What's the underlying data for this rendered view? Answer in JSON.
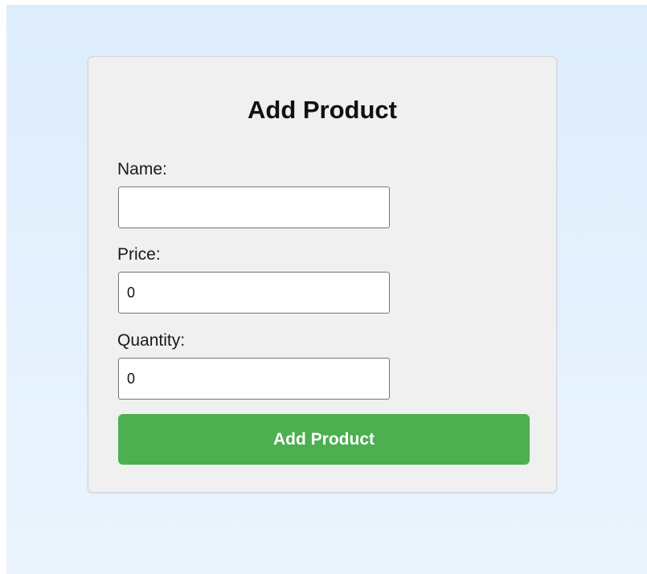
{
  "form": {
    "title": "Add Product",
    "fields": [
      {
        "label": "Name:",
        "value": ""
      },
      {
        "label": "Price:",
        "value": "0"
      },
      {
        "label": "Quantity:",
        "value": "0"
      }
    ],
    "submit_label": "Add Product"
  },
  "colors": {
    "background": "#e3effc",
    "card": "#f0f0f0",
    "button": "#4caf50",
    "button_text": "#ffffff"
  }
}
